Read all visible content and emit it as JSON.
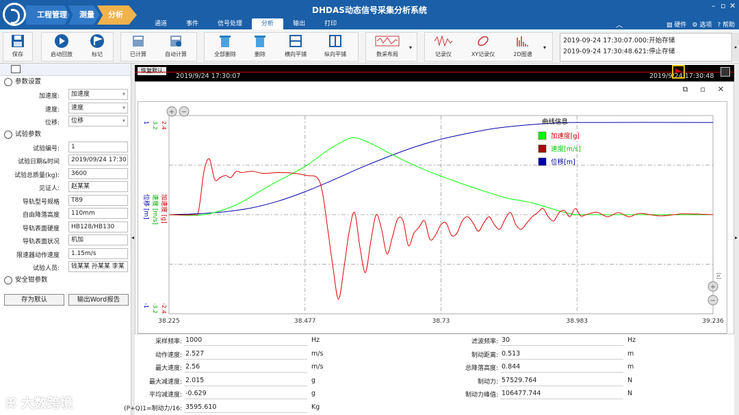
{
  "window": {
    "app_title": "DHDAS动态信号采集分析系统",
    "breadcrumbs": [
      "工程管理",
      "测量",
      "分析"
    ],
    "menu_tabs": [
      "通道",
      "事件",
      "信号处理",
      "分析",
      "输出",
      "打印"
    ],
    "active_tab": "分析",
    "header_right": {
      "hardware": "硬件",
      "options": "选项",
      "help": "帮助"
    }
  },
  "ribbon": {
    "buttons": [
      "保存",
      "启动回放",
      "标记",
      "已计算",
      "自动计算",
      "全部删除",
      "删除",
      "横向平铺",
      "纵向平铺",
      "数采布局",
      "记录仪",
      "XY记录仪",
      "2D图谱"
    ]
  },
  "log": [
    "2019-09-24 17:30:07.000:开始存储",
    "2019-09-24 17:30:48.621:停止存储"
  ],
  "left_panel": {
    "sections": {
      "params": "参数设置",
      "test": "试验参数",
      "safety": "安全钳参数"
    },
    "param_rows": [
      {
        "label": "加速度:",
        "value": "加速度"
      },
      {
        "label": "速度:",
        "value": "速度"
      },
      {
        "label": "位移:",
        "value": "位移"
      }
    ],
    "test_rows": [
      {
        "label": "试验编号:",
        "value": "1"
      },
      {
        "label": "试验日期&时间",
        "value": "2019/09/24 17:30"
      },
      {
        "label": "试验总质量(kg):",
        "value": "3600"
      },
      {
        "label": "见证人:",
        "value": "赵某某"
      },
      {
        "label": "导轨型号规格",
        "value": "T89"
      },
      {
        "label": "自由降落高度",
        "value": "110mm"
      },
      {
        "label": "导轨表面硬度",
        "value": "HB128/HB130"
      },
      {
        "label": "导轨表面状况",
        "value": "机加"
      },
      {
        "label": "限速器动作速度",
        "value": "1.15m/s"
      },
      {
        "label": "试验人员:",
        "value": "钱某某 孙某某 李某"
      }
    ],
    "save_default": "存为默认",
    "export_word": "输出Word报告"
  },
  "timeline": {
    "restore_label": "恢复默认",
    "start": "2019/9/24 17:30:07",
    "end": "2019/9/24 17:30:48"
  },
  "legend": {
    "title": "曲线信息",
    "items": [
      {
        "name": "加速度[g]",
        "color": "#00ff00"
      },
      {
        "name": "速度[m/s]",
        "color": "#a01010"
      },
      {
        "name": "位移[m]",
        "color": "#0000aa"
      }
    ]
  },
  "axes": {
    "y_blue": {
      "label": "位移 [m]",
      "top": "1",
      "bottom": "-1",
      "color": "#0000aa"
    },
    "y_green": {
      "label": "速度 [m/s]",
      "top": "3.2",
      "bottom": "-3.2",
      "color": "#00aa00"
    },
    "y_red": {
      "label": "加速度 [g]",
      "top": "2.4",
      "bottom": "-2.4",
      "color": "#cc0000"
    },
    "x_ticks": [
      "38.225",
      "38.477",
      "38.73",
      "38.983",
      "39.236"
    ],
    "x_unit": "[s]"
  },
  "chart_data": {
    "type": "line",
    "x_range": [
      38.225,
      39.236
    ],
    "series": [
      {
        "name": "位移[m]",
        "color": "#0000aa",
        "axis_range": [
          -1,
          1
        ],
        "x": [
          38.225,
          38.28,
          38.33,
          38.38,
          38.43,
          38.477,
          38.53,
          38.58,
          38.63,
          38.68,
          38.73,
          38.78,
          38.83,
          38.88,
          38.93,
          38.983,
          39.236
        ],
        "y": [
          0,
          0.01,
          0.03,
          0.07,
          0.14,
          0.23,
          0.35,
          0.47,
          0.58,
          0.68,
          0.76,
          0.82,
          0.87,
          0.9,
          0.92,
          0.93,
          0.93
        ]
      },
      {
        "name": "加速度[g]",
        "color": "#00ff00",
        "axis_range": [
          -3.2,
          3.2
        ],
        "x": [
          38.225,
          38.29,
          38.35,
          38.41,
          38.477,
          38.52,
          38.55,
          38.57,
          38.6,
          38.65,
          38.7,
          38.75,
          38.8,
          38.85,
          38.9,
          38.95,
          38.98,
          39.0,
          39.236
        ],
        "y": [
          0,
          0,
          0.32,
          0.92,
          1.55,
          2.08,
          2.38,
          2.48,
          2.3,
          1.85,
          1.45,
          1.12,
          0.82,
          0.55,
          0.38,
          0.12,
          0,
          0,
          0
        ]
      },
      {
        "name": "速度[m/s]",
        "color": "#dd0000",
        "axis_range": [
          -2.4,
          2.4
        ],
        "note_points": "damped oscillation",
        "x": [
          38.225,
          38.27,
          38.28,
          38.29,
          38.3,
          38.31,
          38.32,
          38.33,
          38.34,
          38.35,
          38.36,
          38.38,
          38.4,
          38.43,
          38.46,
          38.48,
          38.5,
          38.51,
          38.52,
          38.53,
          38.54,
          38.55,
          38.56,
          38.57,
          38.58,
          38.59,
          38.6,
          38.61,
          38.62,
          38.63,
          38.64,
          38.65,
          38.66,
          38.67,
          38.68,
          38.69,
          38.7,
          38.71,
          38.72,
          38.73,
          38.74,
          38.75,
          38.76,
          38.77,
          38.78,
          38.79,
          38.8,
          38.81,
          38.82,
          38.83,
          38.84,
          38.85,
          38.86,
          38.87,
          38.88,
          38.89,
          38.9,
          38.91,
          38.92,
          38.93,
          38.94,
          38.95,
          38.96,
          38.97,
          38.98,
          38.99,
          39.0,
          39.02,
          39.04,
          39.06,
          39.08,
          39.1,
          39.14,
          39.18,
          39.236
        ],
        "y": [
          0,
          0,
          0.1,
          1.05,
          1.35,
          0.85,
          0.9,
          0.95,
          0.9,
          1.05,
          1.02,
          1.05,
          1.0,
          1.02,
          1.0,
          0.95,
          0.9,
          0.55,
          -0.35,
          -1.3,
          -2.05,
          -1.3,
          -0.4,
          0.05,
          -0.8,
          -1.4,
          -0.65,
          0.0,
          -0.35,
          -0.95,
          -0.55,
          -0.1,
          -0.15,
          -0.75,
          -0.45,
          -0.3,
          -0.15,
          -0.6,
          -0.5,
          -0.25,
          -0.2,
          -0.5,
          -0.45,
          -0.15,
          -0.05,
          -0.2,
          -0.4,
          -0.2,
          -0.05,
          -0.25,
          -0.35,
          -0.1,
          0.05,
          -0.25,
          -0.35,
          -0.2,
          -0.05,
          0.05,
          0.15,
          -0.05,
          -0.15,
          0.05,
          0.1,
          -0.05,
          0.15,
          -0.03,
          0.0,
          0.06,
          -0.05,
          0.05,
          -0.05,
          0.03,
          -0.03,
          0.02,
          0.0
        ]
      }
    ]
  },
  "params": {
    "left": [
      {
        "label": "采样频率:",
        "value": "1000",
        "unit": "Hz"
      },
      {
        "label": "动作速度:",
        "value": "2.527",
        "unit": "m/s"
      },
      {
        "label": "最大速度:",
        "value": "2.56",
        "unit": "m/s"
      },
      {
        "label": "最大减速度:",
        "value": "2.015",
        "unit": "g"
      },
      {
        "label": "平均减速度:",
        "value": "-0.629",
        "unit": "g"
      },
      {
        "label": "(P+Q)1=制动力/16:",
        "value": "3595.610",
        "unit": "Kg"
      }
    ],
    "right": [
      {
        "label": "滤波频率:",
        "value": "30",
        "unit": "Hz"
      },
      {
        "label": "制动距离:",
        "value": "0.513",
        "unit": "m"
      },
      {
        "label": "总降落高度:",
        "value": "0.844",
        "unit": "m"
      },
      {
        "label": "制动力:",
        "value": "57529.764",
        "unit": "N"
      },
      {
        "label": "制动力峰值:",
        "value": "106477.744",
        "unit": "N"
      }
    ]
  },
  "watermark": "大数跨境"
}
